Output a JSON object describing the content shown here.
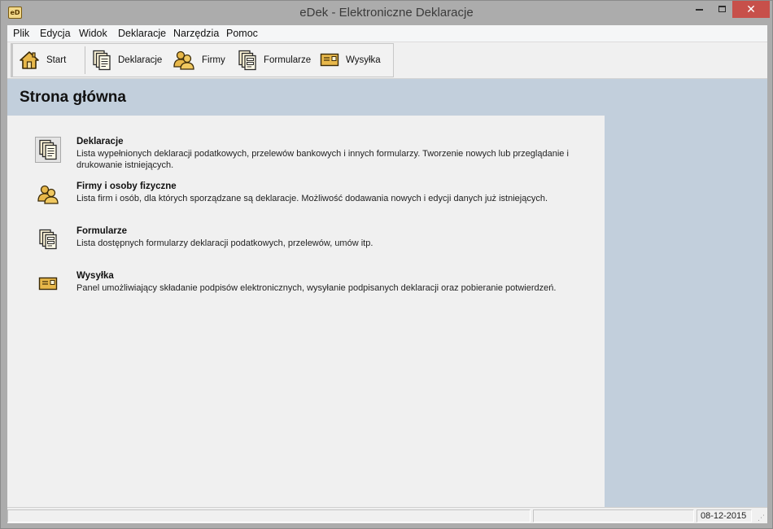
{
  "window": {
    "title": "eDek - Elektroniczne Deklaracje",
    "icon_text": "eD"
  },
  "menu": [
    "Plik",
    "Edycja",
    "Widok",
    "Deklaracje",
    "Narzędzia",
    "Pomoc"
  ],
  "toolbar": {
    "start": "Start",
    "deklaracje": "Deklaracje",
    "firmy": "Firmy",
    "formularze": "Formularze",
    "wysylka": "Wysyłka"
  },
  "page": {
    "title": "Strona główna"
  },
  "entries": [
    {
      "title": "Deklaracje",
      "desc": "Lista wypełnionych deklaracji podatkowych, przelewów bankowych i innych formularzy. Tworzenie nowych lub przeglądanie i drukowanie istniejących.",
      "icon": "documents-icon"
    },
    {
      "title": "Firmy i osoby fizyczne",
      "desc": "Lista firm i osób, dla których sporządzane są deklaracje. Możliwość dodawania nowych i edycji danych już istniejących.",
      "icon": "people-icon"
    },
    {
      "title": "Formularze",
      "desc": "Lista dostępnych formularzy deklaracji podatkowych, przelewów, umów itp.",
      "icon": "forms-icon"
    },
    {
      "title": "Wysyłka",
      "desc": "Panel umożliwiający składanie podpisów elektronicznych, wysyłanie podpisanych deklaracji oraz pobieranie potwierdzeń.",
      "icon": "envelope-icon"
    }
  ],
  "status": {
    "date": "08-12-2015"
  },
  "colors": {
    "header_band": "#c2cfdc",
    "icon_gold": "#e8b84a",
    "close_button": "#c7504a"
  }
}
